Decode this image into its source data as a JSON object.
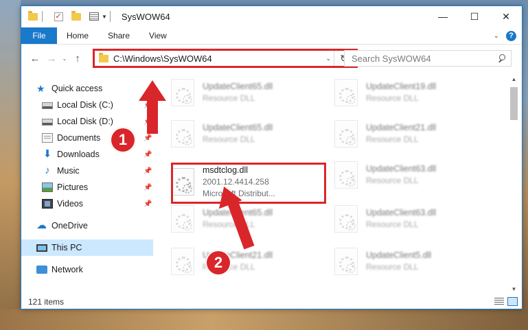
{
  "window": {
    "title": "SysWOW64",
    "controls": {
      "minimize": "—",
      "maximize": "☐",
      "close": "✕"
    }
  },
  "ribbon": {
    "file_label": "File",
    "tabs": [
      "Home",
      "Share",
      "View"
    ]
  },
  "nav": {
    "back": "←",
    "forward": "→",
    "recent": "⌄",
    "up": "↑",
    "address": "C:\\Windows\\SysWOW64",
    "refresh": "↻",
    "search_placeholder": "Search SysWOW64"
  },
  "sidebar": {
    "items": [
      {
        "label": "Quick access",
        "icon": "star-icon"
      },
      {
        "label": "Local Disk (C:)",
        "icon": "disk-icon",
        "pinned": true
      },
      {
        "label": "Local Disk (D:)",
        "icon": "disk-icon",
        "pinned": true
      },
      {
        "label": "Documents",
        "icon": "documents-icon",
        "pinned": true
      },
      {
        "label": "Downloads",
        "icon": "downloads-icon",
        "pinned": true
      },
      {
        "label": "Music",
        "icon": "music-icon",
        "pinned": true
      },
      {
        "label": "Pictures",
        "icon": "pictures-icon",
        "pinned": true
      },
      {
        "label": "Videos",
        "icon": "videos-icon",
        "pinned": true
      },
      {
        "label": "OneDrive",
        "icon": "onedrive-icon"
      },
      {
        "label": "This PC",
        "icon": "this-pc-icon",
        "selected": true
      },
      {
        "label": "Network",
        "icon": "network-icon"
      }
    ]
  },
  "files": [
    {
      "name": "UpdateClient65.dll",
      "sub": "Resource DLL",
      "blurred": true
    },
    {
      "name": "UpdateClient19.dll",
      "sub": "Resource DLL",
      "blurred": true
    },
    {
      "name": "UpdateClient65.dll",
      "sub": "Resource DLL",
      "blurred": true
    },
    {
      "name": "UpdateClient21.dll",
      "sub": "Resource DLL",
      "blurred": true
    },
    {
      "name": "msdtclog.dll",
      "sub": "2001.12.4414.258",
      "sub2": "Microsoft Distribut...",
      "blurred": false
    },
    {
      "name": "UpdateClient63.dll",
      "sub": "Resource DLL",
      "blurred": true
    },
    {
      "name": "UpdateClient65.dll",
      "sub": "Resource DLL",
      "blurred": true
    },
    {
      "name": "UpdateClient63.dll",
      "sub": "Resource DLL",
      "blurred": true
    },
    {
      "name": "UpdateClient21.dll",
      "sub": "Resource DLL",
      "blurred": true
    },
    {
      "name": "UpdateClient5.dll",
      "sub": "Resource DLL",
      "blurred": true
    }
  ],
  "status": {
    "item_count": "121 items"
  },
  "markers": {
    "step1": "1",
    "step2": "2"
  },
  "colors": {
    "accent": "#1979ca",
    "highlight": "#d9262a",
    "selected": "#cce8ff"
  }
}
